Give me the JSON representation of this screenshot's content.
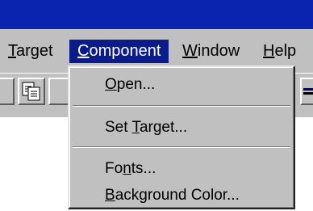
{
  "menubar": {
    "items": [
      {
        "label": "Target",
        "accel": "T",
        "rest": "arget"
      },
      {
        "label": "Component",
        "accel": "C",
        "rest": "omponent"
      },
      {
        "label": "Window",
        "accel": "W",
        "rest": "indow"
      },
      {
        "label": "Help",
        "accel": "H",
        "rest": "elp"
      }
    ],
    "active_label": "Component"
  },
  "toolbar": {
    "buttons": [
      "copy-icon"
    ]
  },
  "dropdown": {
    "items": [
      {
        "label": "Open...",
        "pre": "",
        "accel": "O",
        "post": "pen..."
      },
      {
        "label": "Set Target...",
        "pre": "Set ",
        "accel": "T",
        "post": "arget..."
      },
      {
        "label": "Fonts...",
        "pre": "Fo",
        "accel": "n",
        "post": "ts..."
      },
      {
        "label": "Background Color...",
        "pre": "",
        "accel": "B",
        "post": "ackground Color..."
      }
    ]
  },
  "colors": {
    "titlebar": "#0a24b0",
    "menu_highlight": "#0a1c8c",
    "face": "#c0c0c0"
  }
}
